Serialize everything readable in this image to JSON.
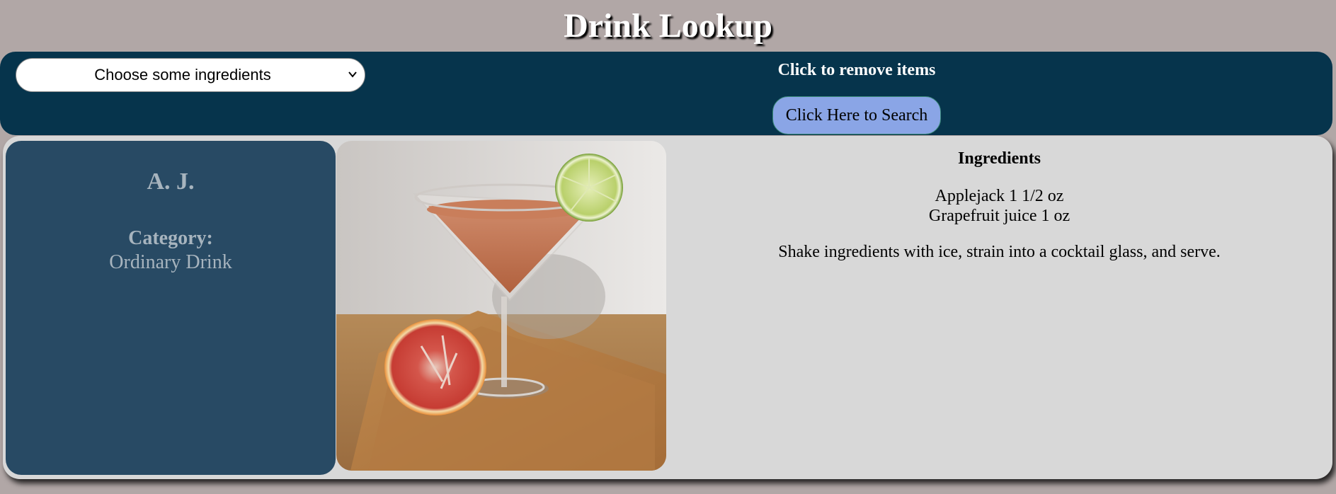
{
  "header": {
    "title": "Drink Lookup"
  },
  "toolbar": {
    "ingredient_select": {
      "selected": "Choose some ingredients",
      "options": [
        "Choose some ingredients"
      ]
    },
    "remove_hint": "Click to remove items",
    "search_button_label": "Click Here to Search"
  },
  "drink": {
    "name": "A. J.",
    "category_label": "Category:",
    "category": "Ordinary Drink",
    "photo_icon": "cocktail-photo",
    "ingredients_heading": "Ingredients",
    "ingredients": [
      "Applejack 1 1/2 oz",
      "Grapefruit juice 1 oz"
    ],
    "instructions": "Shake ingredients with ice, strain into a cocktail glass, and serve."
  },
  "colors": {
    "page_background": "#b1a7a6",
    "toolbar_background": "#06344c",
    "search_button": "#8aa5e6",
    "info_card": "#284a64",
    "results_panel": "#d8d8d8"
  }
}
